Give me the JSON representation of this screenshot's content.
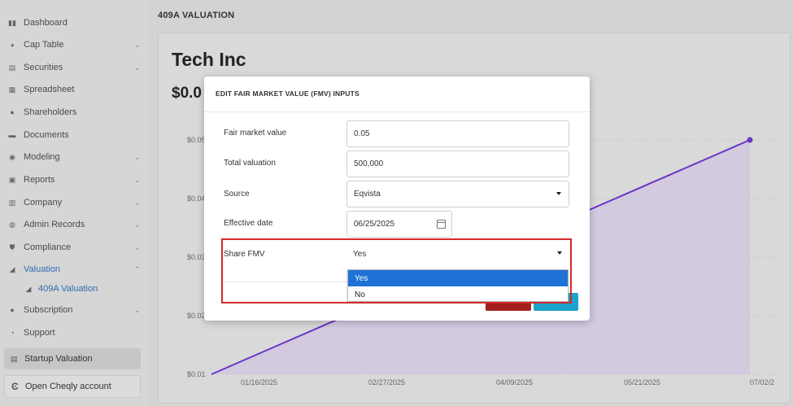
{
  "sidebar": {
    "items": [
      {
        "label": "Dashboard",
        "icon": "dashboard-icon",
        "chevron": false
      },
      {
        "label": "Cap Table",
        "icon": "pie-chart-icon",
        "chevron": true
      },
      {
        "label": "Securities",
        "icon": "clipboard-icon",
        "chevron": true
      },
      {
        "label": "Spreadsheet",
        "icon": "spreadsheet-icon",
        "chevron": false
      },
      {
        "label": "Shareholders",
        "icon": "user-icon",
        "chevron": false
      },
      {
        "label": "Documents",
        "icon": "folder-icon",
        "chevron": false
      },
      {
        "label": "Modeling",
        "icon": "lightbulb-icon",
        "chevron": true
      },
      {
        "label": "Reports",
        "icon": "report-icon",
        "chevron": true
      },
      {
        "label": "Company",
        "icon": "building-icon",
        "chevron": true
      },
      {
        "label": "Admin Records",
        "icon": "admin-icon",
        "chevron": true
      },
      {
        "label": "Compliance",
        "icon": "shield-icon",
        "chevron": true
      },
      {
        "label": "Valuation",
        "icon": "valuation-icon",
        "chevron": true
      },
      {
        "label": "409A Valuation",
        "icon": "valuation-sub-icon",
        "chevron": false
      },
      {
        "label": "Subscription",
        "icon": "subscription-icon",
        "chevron": true
      },
      {
        "label": "Support",
        "icon": "support-icon",
        "chevron": false
      }
    ],
    "startup_valuation": "Startup Valuation",
    "open_cheqly": "Open Cheqly account"
  },
  "header": {
    "title": "409A VALUATION"
  },
  "main": {
    "company": "Tech Inc",
    "price": "$0.0"
  },
  "chart_data": {
    "type": "area",
    "x": [
      "2025-01-01",
      "2025-07-02"
    ],
    "y": [
      0.01,
      0.05
    ],
    "yticks": [
      "$0.05",
      "$0.04",
      "$0.03",
      "$0.02",
      "$0.01"
    ],
    "xticks": [
      "01/16/2025",
      "02/27/2025",
      "04/09/2025",
      "05/21/2025",
      "07/02/2"
    ],
    "line_color": "#6a35c8",
    "fill_color": "#cfc5e0"
  },
  "modal": {
    "title": "EDIT FAIR MARKET VALUE (FMV) INPUTS",
    "fields": {
      "fmv_label": "Fair market value",
      "fmv_value": "0.05",
      "total_label": "Total valuation",
      "total_value": "500,000",
      "source_label": "Source",
      "source_value": "Eqvista",
      "date_label": "Effective date",
      "date_value": "06/25/2025",
      "share_label": "Share FMV",
      "share_value": "Yes"
    },
    "share_options": [
      "Yes",
      "No"
    ],
    "colors": {
      "cancel": "#a3201e",
      "save": "#1ba3cc",
      "selected_option": "#1e72d6",
      "highlight": "#d42a2a"
    }
  }
}
